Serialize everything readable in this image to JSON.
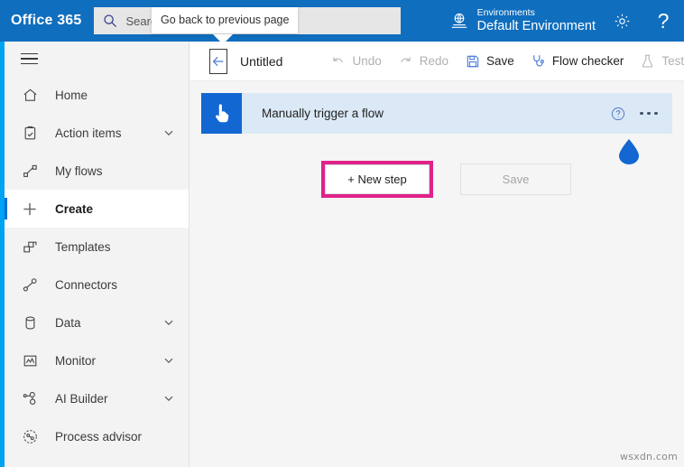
{
  "suite_bar": {
    "logo": "Office 365",
    "search": {
      "placeholder": "Search",
      "value": "",
      "icon": "search-icon"
    },
    "environment": {
      "icon": "globe-icon",
      "label": "Environments",
      "value": "Default Environment"
    },
    "settings_icon": "gear-icon",
    "help_icon": "question-mark-icon",
    "background_color": "#106ebe"
  },
  "tooltip": {
    "text": "Go back to previous page"
  },
  "sidebar": {
    "hamburger_label": "hamburger-menu",
    "accent_color": "#00a2f3",
    "items": [
      {
        "label": "Home",
        "icon": "home-icon",
        "expandable": false,
        "selected": false
      },
      {
        "label": "Action items",
        "icon": "clipboard-check-icon",
        "expandable": true,
        "selected": false
      },
      {
        "label": "My flows",
        "icon": "flow-icon",
        "expandable": false,
        "selected": false
      },
      {
        "label": "Create",
        "icon": "plus-icon",
        "expandable": false,
        "selected": true
      },
      {
        "label": "Templates",
        "icon": "templates-icon",
        "expandable": false,
        "selected": false
      },
      {
        "label": "Connectors",
        "icon": "connectors-icon",
        "expandable": false,
        "selected": false
      },
      {
        "label": "Data",
        "icon": "database-icon",
        "expandable": true,
        "selected": false
      },
      {
        "label": "Monitor",
        "icon": "monitor-chart-icon",
        "expandable": true,
        "selected": false
      },
      {
        "label": "AI Builder",
        "icon": "ai-builder-icon",
        "expandable": true,
        "selected": false
      },
      {
        "label": "Process advisor",
        "icon": "process-advisor-icon",
        "expandable": false,
        "selected": false
      }
    ]
  },
  "designer_toolbar": {
    "back_button_icon": "arrow-left-icon",
    "flow_title": "Untitled",
    "buttons": [
      {
        "label": "Undo",
        "icon": "undo-icon",
        "state": "disabled"
      },
      {
        "label": "Redo",
        "icon": "redo-icon",
        "state": "disabled"
      },
      {
        "label": "Save",
        "icon": "save-disk-icon",
        "state": "active"
      },
      {
        "label": "Flow checker",
        "icon": "stethoscope-icon",
        "state": "active"
      },
      {
        "label": "Test",
        "icon": "flask-icon",
        "state": "disabled"
      }
    ]
  },
  "canvas": {
    "trigger_card": {
      "icon": "hand-tap-icon",
      "title": "Manually trigger a flow",
      "help_icon": "help-circle-icon",
      "more_icon": "ellipsis-icon",
      "background_color": "#dbe9f7",
      "icon_color": "#1267d2"
    },
    "cursor_marker": {
      "icon": "water-drop-icon",
      "color": "#1267d2"
    },
    "new_step_button": {
      "label": "+ New step",
      "highlight_color": "#e0218a"
    },
    "save_button": {
      "label": "Save",
      "state": "disabled"
    }
  },
  "watermark": {
    "text": "wsxdn.com"
  }
}
